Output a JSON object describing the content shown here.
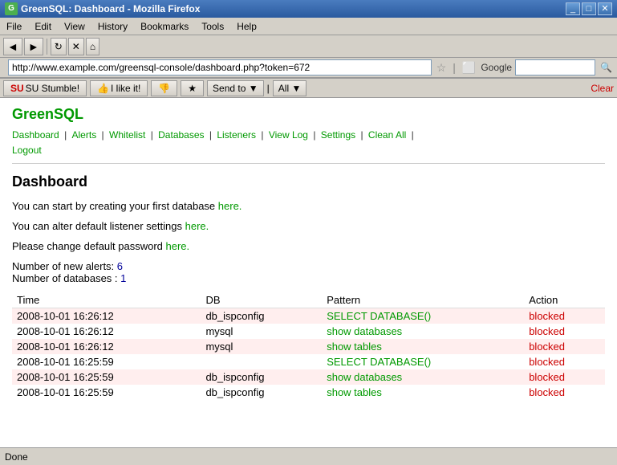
{
  "window": {
    "title": "GreenSQL: Dashboard - Mozilla Firefox",
    "icon": "G"
  },
  "menubar": {
    "items": [
      "File",
      "Edit",
      "View",
      "History",
      "Bookmarks",
      "Tools",
      "Help"
    ]
  },
  "toolbar": {
    "back_label": "◄",
    "forward_label": "►",
    "reload_label": "↻",
    "stop_label": "✕",
    "home_label": "⌂"
  },
  "address_bar": {
    "url": "http://www.example.com/greensql-console/dashboard.php?token=672",
    "google_placeholder": "Google"
  },
  "stumble_bar": {
    "stumble_label": "SU Stumble!",
    "like_label": "I like it!",
    "thumb_label": "👍",
    "send_to_label": "Send to",
    "all_label": "All",
    "clear_label": "Clear"
  },
  "greensql": {
    "title": "GreenSQL",
    "nav": {
      "items": [
        "Dashboard",
        "Alerts",
        "Whitelist",
        "Databases",
        "Listeners",
        "View Log",
        "Settings",
        "Clean All",
        "Logout"
      ]
    }
  },
  "page": {
    "title": "Dashboard",
    "messages": [
      {
        "text": "You can start by creating your first database ",
        "link_text": "here.",
        "link": "#"
      },
      {
        "text": "You can alter default listener settings ",
        "link_text": "here.",
        "link": "#"
      },
      {
        "text": "Please change default password ",
        "link_text": "here.",
        "link": "#"
      }
    ],
    "stats": {
      "alerts_label": "Number of new alerts: ",
      "alerts_value": "6",
      "databases_label": "Number of databases : ",
      "databases_value": "1"
    },
    "table": {
      "headers": [
        "Time",
        "DB",
        "Pattern",
        "Action"
      ],
      "rows": [
        {
          "time": "2008-10-01 16:26:12",
          "db": "db_ispconfig",
          "pattern": "SELECT DATABASE()",
          "action": "blocked"
        },
        {
          "time": "2008-10-01 16:26:12",
          "db": "mysql",
          "pattern": "show databases",
          "action": "blocked"
        },
        {
          "time": "2008-10-01 16:26:12",
          "db": "mysql",
          "pattern": "show tables",
          "action": "blocked"
        },
        {
          "time": "2008-10-01 16:25:59",
          "db": "",
          "pattern": "SELECT DATABASE()",
          "action": "blocked"
        },
        {
          "time": "2008-10-01 16:25:59",
          "db": "db_ispconfig",
          "pattern": "show databases",
          "action": "blocked"
        },
        {
          "time": "2008-10-01 16:25:59",
          "db": "db_ispconfig",
          "pattern": "show tables",
          "action": "blocked"
        }
      ]
    }
  },
  "statusbar": {
    "text": "Done"
  }
}
